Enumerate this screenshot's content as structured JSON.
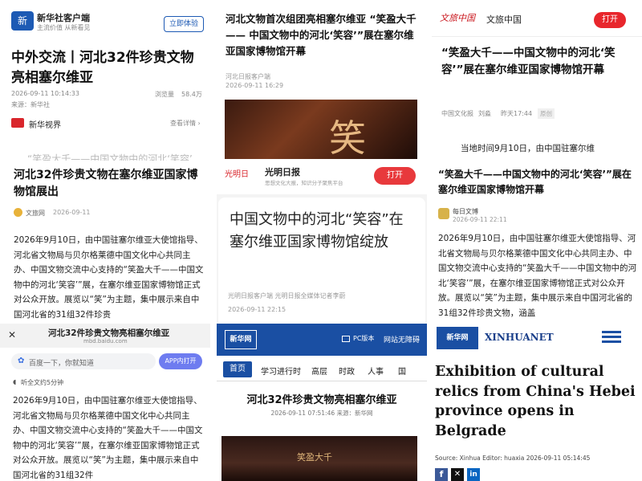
{
  "p1": {
    "app_name": "新华社客户端",
    "app_slogan": "主流价值 从新看见",
    "open_button": "立即体验",
    "title": "中外交流丨河北32件珍贵文物亮相塞尔维亚",
    "date": "2026-09-11 10:14:33",
    "views_label": "浏览量",
    "views": "58.4万",
    "source": "来源：新华社",
    "channel": "新华视界",
    "view_detail": "查看详情 ›",
    "faded": "“笑盈大千——中国文物中的河北‘笑容’"
  },
  "p2": {
    "title": "河北32件珍贵文物在塞尔维亚国家博物馆展出",
    "author": "文旅网",
    "date": "2026-09-11",
    "body": "2026年9月10日，由中国驻塞尔维亚大使馆指导、河北省文物局与贝尔格莱德中国文化中心共同主办、中国文物交流中心支持的“笑盈大千——中国文物中的河北‘笑容’”展，在塞尔维亚国家博物馆正式对公众开放。展览以“笑”为主题，集中展示来自中国河北省的31组32件珍贵"
  },
  "p3": {
    "title": "河北32件珍贵文物亮相塞尔维亚",
    "url": "mbd.baidu.com",
    "search_placeholder": "百度一下，你就知道",
    "app_open": "APP内打开",
    "listen": "听全文约5分钟",
    "body": "2026年9月10日，由中国驻塞尔维亚大使馆指导、河北省文物局与贝尔格莱德中国文化中心共同主办、中国文物交流中心支持的“笑盈大千——中国文物中的河北‘笑容’”展，在塞尔维亚国家博物馆正式对公众开放。展览以“笑”为主题，集中展示来自中国河北省的31组32件"
  },
  "p4": {
    "title": "河北文物首次组团亮相塞尔维亚 “笑盈大千 —— 中国文物中的河北‘笑容’”展在塞尔维亚国家博物馆开幕",
    "source": "河北日报客户端",
    "date": "2026-09-11 16:29",
    "image_char": "笑"
  },
  "p5": {
    "app_name": "光明日报",
    "app_sub": "思想文化大报，知识分子聚焦平台",
    "open_button": "打开",
    "title": "中国文物中的河北“笑容”在塞尔维亚国家博物馆绽放",
    "source": "光明日报客户端  光明日报全媒体记者李蔚",
    "date": "2026-09-11 22:15"
  },
  "p6": {
    "logo": "新华网",
    "pc_label": "PC版本",
    "accessible": "网站无障碍",
    "nav": [
      "首页",
      "学习进行时",
      "高层",
      "时政",
      "人事",
      "国"
    ],
    "title": "河北32件珍贵文物亮相塞尔维亚",
    "meta": "2026-09-11 07:51:46 来源：新华网",
    "image_text": "笑盈大千"
  },
  "p7": {
    "logo_text": "文旅中国",
    "app_name": "文旅中国",
    "open_button": "打开",
    "title": "“笑盈大千——中国文物中的河北‘笑容’”展在塞尔维亚国家博物馆开幕",
    "source": "中国文化报",
    "author": "刘淼",
    "time": "昨天17:44",
    "tag": "原创",
    "lead": "当地时间9月10日，由中国驻塞尔维"
  },
  "p8": {
    "title": "“笑盈大千——中国文物中的河北‘笑容’”展在塞尔维亚国家博物馆开幕",
    "source": "每日文博",
    "date": "2026-09-11 22:11",
    "body": "2026年9月10日，由中国驻塞尔维亚大使馆指导、河北省文物局与贝尔格莱德中国文化中心共同主办、中国文物交流中心支持的“笑盈大千——中国文物中的河北‘笑容’”展，在塞尔维亚国家博物馆正式对公众开放。展览以“笑”为主题，集中展示来自中国河北省的31组32件珍贵文物，涵盖"
  },
  "p9": {
    "logo_text": "新华网",
    "brand": "XINHUANET",
    "title": "Exhibition of cultural relics from China's Hebei province opens in Belgrade",
    "meta": "Source: Xinhua  Editor: huaxia  2026-09-11 05:14:45"
  },
  "colors": {
    "accent_red": "#d9262c",
    "xinhua_blue": "#1a4fa3",
    "dark": "#1a1a1a"
  }
}
